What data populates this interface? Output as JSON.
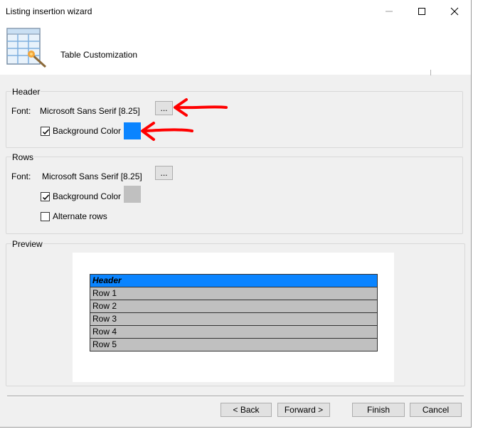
{
  "window": {
    "title": "Listing insertion wizard"
  },
  "banner": {
    "title": "Table Customization",
    "icon": "table-wizard-icon"
  },
  "header_group": {
    "label": "Header",
    "font_label": "Font:",
    "font_value": "Microsoft Sans Serif [8.25]",
    "font_button": "...",
    "bg_color_label": "Background Color",
    "bg_color_checked": true,
    "bg_color": "#0a84ff"
  },
  "rows_group": {
    "label": "Rows",
    "font_label": "Font:",
    "font_value": "Microsoft Sans Serif [8.25]",
    "font_button": "...",
    "bg_color_label": "Background Color",
    "bg_color_checked": true,
    "bg_color": "#c0c0c0",
    "alternate_label": "Alternate rows",
    "alternate_checked": false
  },
  "preview": {
    "label": "Preview",
    "header_text": "Header",
    "rows": [
      "Row 1",
      "Row 2",
      "Row 3",
      "Row 4",
      "Row 5"
    ]
  },
  "footer": {
    "back": "< Back",
    "forward": "Forward >",
    "finish": "Finish",
    "cancel": "Cancel"
  },
  "colors": {
    "annotation_arrow": "#ff0000"
  }
}
